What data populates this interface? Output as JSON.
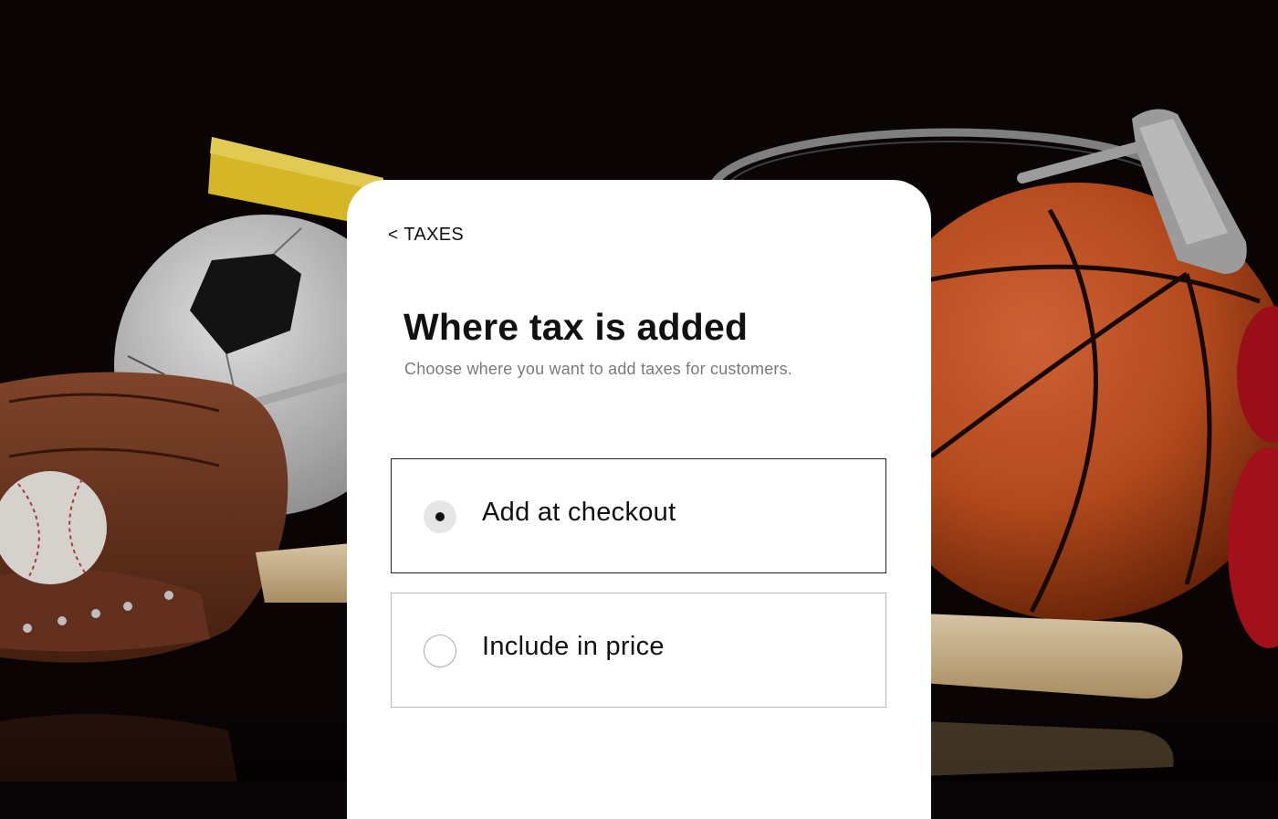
{
  "background": {
    "description_icon": "sports-equipment-photo"
  },
  "nav": {
    "back_chevron": "<",
    "back_label": "TAXES"
  },
  "header": {
    "title": "Where tax is added",
    "subtitle": "Choose where you want to add taxes for customers."
  },
  "options": [
    {
      "label": "Add at checkout",
      "selected": true
    },
    {
      "label": "Include in price",
      "selected": false
    }
  ],
  "colors": {
    "card_bg": "#ffffff",
    "selected_border": "#222222",
    "unselected_border": "#b8b8b8",
    "subtitle": "#7a7a7a"
  }
}
